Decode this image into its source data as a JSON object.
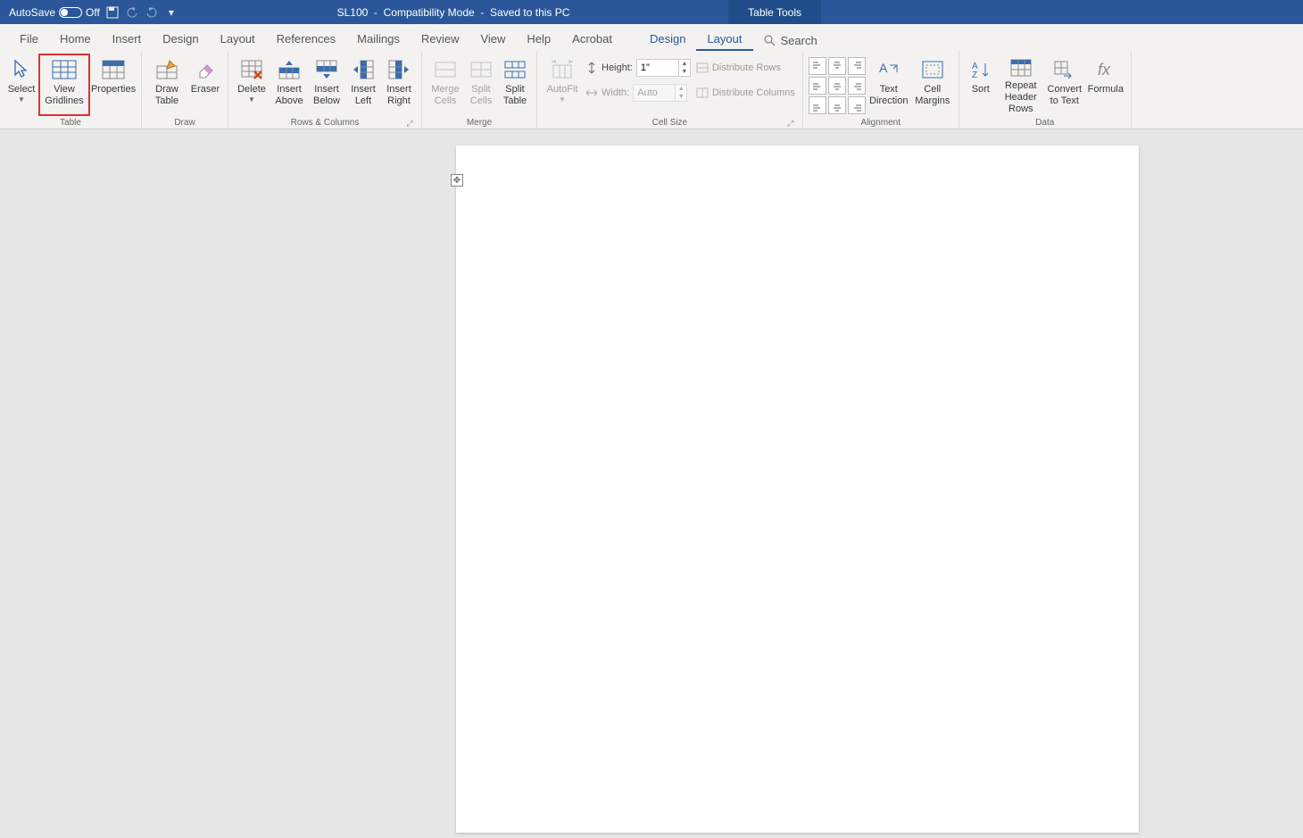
{
  "titlebar": {
    "autosave_label": "AutoSave",
    "autosave_state": "Off",
    "doc_name": "SL100",
    "mode": "Compatibility Mode",
    "save_state": "Saved to this PC",
    "table_tools": "Table Tools"
  },
  "tabs": {
    "items": [
      "File",
      "Home",
      "Insert",
      "Design",
      "Layout",
      "References",
      "Mailings",
      "Review",
      "View",
      "Help",
      "Acrobat"
    ],
    "context": [
      "Design",
      "Layout"
    ],
    "active": "Layout",
    "search": "Search"
  },
  "ribbon": {
    "groups": {
      "table": {
        "label": "Table",
        "select": "Select",
        "view_gridlines": "View Gridlines",
        "properties": "Properties"
      },
      "draw": {
        "label": "Draw",
        "draw_table": "Draw Table",
        "eraser": "Eraser"
      },
      "rows_cols": {
        "label": "Rows & Columns",
        "delete": "Delete",
        "insert_above": "Insert Above",
        "insert_below": "Insert Below",
        "insert_left": "Insert Left",
        "insert_right": "Insert Right"
      },
      "merge": {
        "label": "Merge",
        "merge_cells": "Merge Cells",
        "split_cells": "Split Cells",
        "split_table": "Split Table"
      },
      "cell_size": {
        "label": "Cell Size",
        "autofit": "AutoFit",
        "height_label": "Height:",
        "height_value": "1\"",
        "width_label": "Width:",
        "width_value": "Auto",
        "dist_rows": "Distribute Rows",
        "dist_cols": "Distribute Columns"
      },
      "alignment": {
        "label": "Alignment",
        "text_direction": "Text Direction",
        "cell_margins": "Cell Margins"
      },
      "data": {
        "label": "Data",
        "sort": "Sort",
        "repeat_header": "Repeat Header Rows",
        "convert": "Convert to Text",
        "formula": "Formula"
      }
    }
  }
}
